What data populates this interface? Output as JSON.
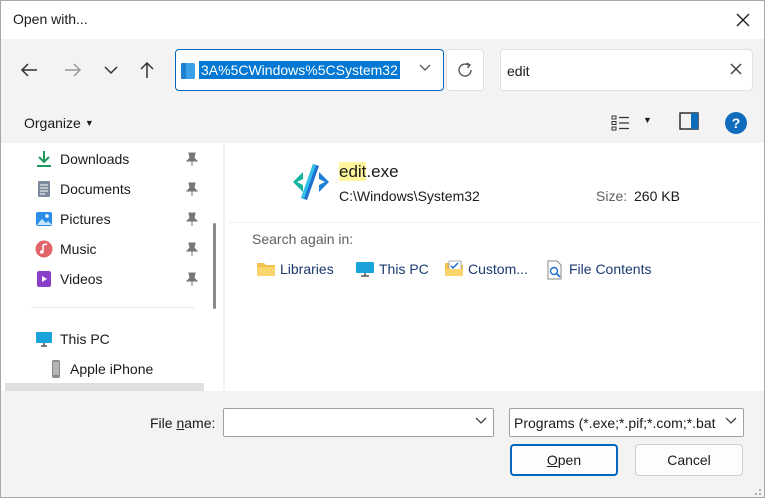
{
  "window": {
    "title": "Open with..."
  },
  "address": {
    "path": "3A%5CWindows%5CSystem32"
  },
  "search": {
    "query": "edit"
  },
  "toolbar": {
    "organize_label": "Organize"
  },
  "sidebar": {
    "items": [
      {
        "label": "Downloads",
        "icon": "download-icon",
        "pinned": true
      },
      {
        "label": "Documents",
        "icon": "documents-icon",
        "pinned": true
      },
      {
        "label": "Pictures",
        "icon": "pictures-icon",
        "pinned": true
      },
      {
        "label": "Music",
        "icon": "music-icon",
        "pinned": true
      },
      {
        "label": "Videos",
        "icon": "videos-icon",
        "pinned": true
      },
      {
        "label": "This PC",
        "icon": "this-pc-icon",
        "pinned": false
      },
      {
        "label": "Apple iPhone",
        "icon": "phone-icon",
        "pinned": false
      }
    ]
  },
  "result": {
    "name_highlight": "edit",
    "name_rest": ".exe",
    "path": "C:\\Windows\\System32",
    "size_label": "Size:",
    "size_value": "260 KB"
  },
  "search_again": {
    "heading": "Search again in:",
    "locations": [
      {
        "label": "Libraries",
        "icon": "libraries-folder-icon"
      },
      {
        "label": "This PC",
        "icon": "this-pc-icon"
      },
      {
        "label": "Custom...",
        "icon": "custom-folder-icon"
      },
      {
        "label": "File Contents",
        "icon": "file-contents-icon"
      }
    ]
  },
  "footer": {
    "file_name_label_pre": "File ",
    "file_name_label_ul": "n",
    "file_name_label_post": "ame:",
    "file_name_value": "",
    "filter_value": "Programs (*.exe;*.pif;*.com;*.bat",
    "open_ul": "O",
    "open_rest": "pen",
    "cancel_label": "Cancel"
  },
  "colors": {
    "accent": "#0067c0",
    "highlight": "#fff59d",
    "help": "#0f6cbd"
  }
}
